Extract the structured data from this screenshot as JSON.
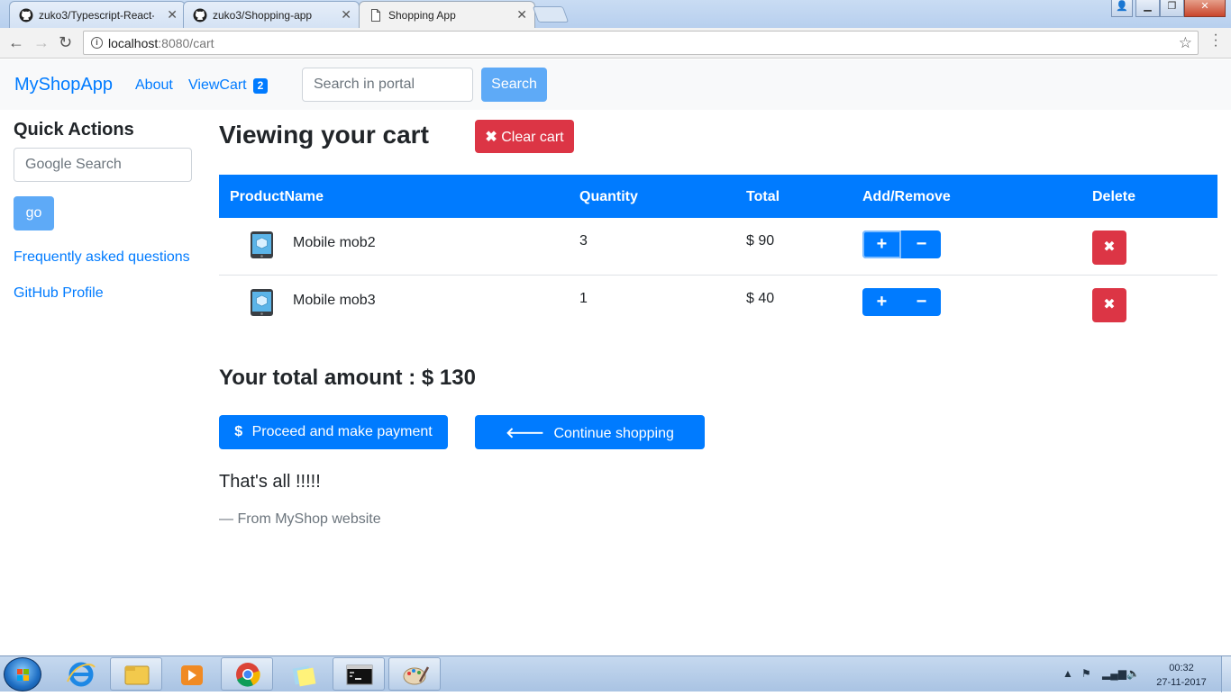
{
  "browser": {
    "tabs": [
      {
        "title": "zuko3/Typescript-React-",
        "icon": "github-icon",
        "active": false
      },
      {
        "title": "zuko3/Shopping-app",
        "icon": "github-icon",
        "active": false
      },
      {
        "title": "Shopping App",
        "icon": "page-icon",
        "active": true
      }
    ],
    "url_host": "localhost",
    "url_path": ":8080/cart"
  },
  "navbar": {
    "brand": "MyShopApp",
    "about": "About",
    "viewcart": "ViewCart",
    "cart_count": "2",
    "search_placeholder": "Search in portal",
    "search_button": "Search"
  },
  "sidebar": {
    "title": "Quick Actions",
    "google_placeholder": "Google Search",
    "go_button": "go",
    "links": [
      "Frequently asked questions",
      "GitHub Profile"
    ]
  },
  "cart": {
    "title": "Viewing your cart",
    "clear_button": "Clear cart",
    "headers": [
      "ProductName",
      "Quantity",
      "Total",
      "Add/Remove",
      "Delete"
    ],
    "rows": [
      {
        "name": "Mobile mob2",
        "quantity": "3",
        "total": "$ 90"
      },
      {
        "name": "Mobile mob3",
        "quantity": "1",
        "total": "$ 40"
      }
    ],
    "total_label": "Your total amount : $ 130",
    "pay_button": "Proceed and make payment",
    "continue_button": "Continue shopping",
    "quote": "That's all !!!!!",
    "quote_footer": "— From MyShop website"
  },
  "taskbar": {
    "time": "00:32",
    "date": "27-11-2017"
  },
  "colors": {
    "primary": "#007bff",
    "danger": "#dc3545",
    "light_button": "#5eaaf7",
    "navbar_bg": "#f8f9fa"
  }
}
